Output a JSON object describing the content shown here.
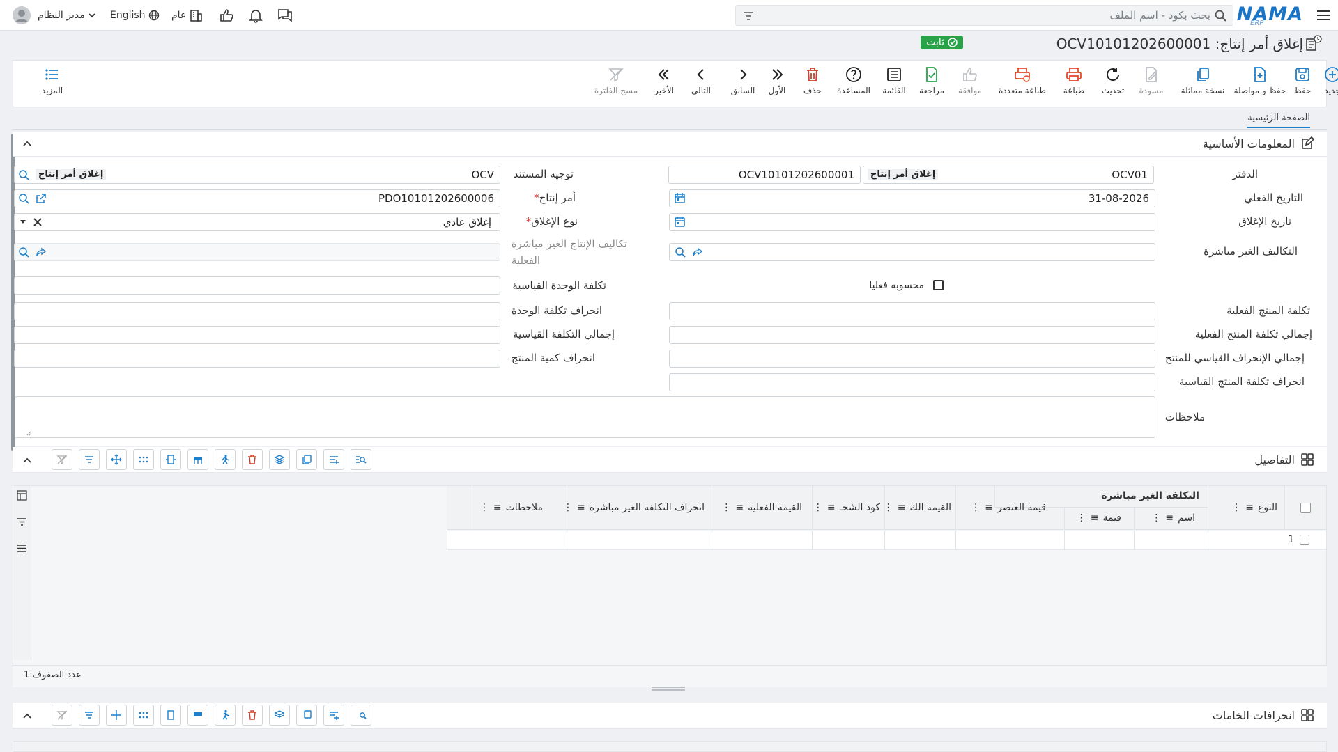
{
  "header": {
    "logo_text": "NAMA",
    "logo_sub": "ERP",
    "search_placeholder": "بحث بكود - اسم الملف",
    "user_name": "مدير النظام",
    "language": "English",
    "general": "عام"
  },
  "document": {
    "title": "إغلاق أمر إنتاج: OCV10101202600001",
    "status": "ثابت"
  },
  "toolbar": {
    "new": "جديد",
    "save": "حفظ",
    "save_continue": "حفظ و مواصلة",
    "duplicate": "نسخة مماثلة",
    "draft": "مسودة",
    "refresh": "تحديث",
    "print": "طباعة",
    "multi_print": "طباعة متعددة",
    "approve": "موافقة",
    "review": "مراجعة",
    "list": "القائمة",
    "help": "المساعدة",
    "delete": "حذف",
    "first": "الأول",
    "previous": "السابق",
    "next": "التالي",
    "last": "الأخير",
    "clear_filter": "مسح الفلترة",
    "more": "المزيد"
  },
  "tabs": {
    "main": "الصفحة الرئيسية"
  },
  "basic_info": {
    "section_title": "المعلومات الأساسية",
    "book_label": "الدفتر",
    "book_value": "OCV01",
    "book_tag": "إغلاق أمر إنتاج",
    "doc_code": "OCV10101202600001",
    "direction_label": "توجيه المستند",
    "direction_value": "OCV",
    "direction_tag": "إغلاق أمر إنتاج",
    "actual_date_label": "التاريخ الفعلي",
    "actual_date_value": "31-08-2026",
    "prod_order_label": "أمر إنتاج",
    "prod_order_value": "PDO10101202600006",
    "close_date_label": "تاريخ الإغلاق",
    "close_type_label": "نوع الإغلاق",
    "close_type_value": "إغلاق عادي",
    "indirect_costs_label": "التكاليف الغير مباشرة",
    "actual_indirect_label_1": "تكاليف الإنتاج الغير مباشرة",
    "actual_indirect_label_2": "الفعلية",
    "actually_calculated_label": "محسوبه فعليا",
    "std_unit_cost_label": "تكلفة الوحدة القياسية",
    "actual_product_cost_label": "تكلفة المنتج الفعلية",
    "unit_cost_variance_label": "انحراف تكلفة الوحدة",
    "total_actual_product_cost_label": "إجمالي تكلفة المنتج الفعلية",
    "total_std_cost_label": "إجمالي التكلفة القياسية",
    "total_std_variance_label": "إجمالي الإنحراف القياسي للمنتج",
    "product_qty_variance_label": "انحراف كمية المنتج",
    "std_product_cost_variance_label": "انحراف تكلفة المنتج القياسية",
    "notes_label": "ملاحظات"
  },
  "details": {
    "section_title": "التفاصيل",
    "columns": {
      "type": "النوع",
      "indirect_cost_group": "التكلفة الغير مباشرة",
      "name": "اسم",
      "value": "قيمة",
      "element_value": "قيمة العنصر",
      "total_value": "القيمة الك",
      "shipment_code": "كود الشحـ",
      "actual_value": "القيمة الفعلية",
      "indirect_variance": "انحراف التكلفة الغير مباشرة",
      "notes": "ملاحظات"
    },
    "rows": [
      {
        "index": "1"
      }
    ],
    "row_count_label": "عدد الصفوف:",
    "row_count": "1"
  },
  "materials": {
    "section_title": "انحرافات الخامات"
  }
}
